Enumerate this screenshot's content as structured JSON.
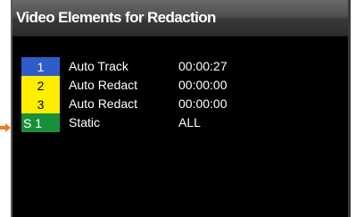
{
  "panel": {
    "title": "Video Elements for Redaction"
  },
  "elements": [
    {
      "badge": "1",
      "badge_color": "#2e5cc8",
      "name": "Auto Track",
      "time": "00:00:27"
    },
    {
      "badge": "2",
      "badge_color": "#ffee00",
      "name": "Auto Redact",
      "time": "00:00:00"
    },
    {
      "badge": "3",
      "badge_color": "#ffee00",
      "name": "Auto Redact",
      "time": "00:00:00"
    },
    {
      "badge": "S  1",
      "badge_color": "#1a8f3a",
      "name": "Static",
      "time": "ALL"
    }
  ],
  "pointer": {
    "icon": "orange-arrow-icon",
    "color": "#f07a1a"
  }
}
